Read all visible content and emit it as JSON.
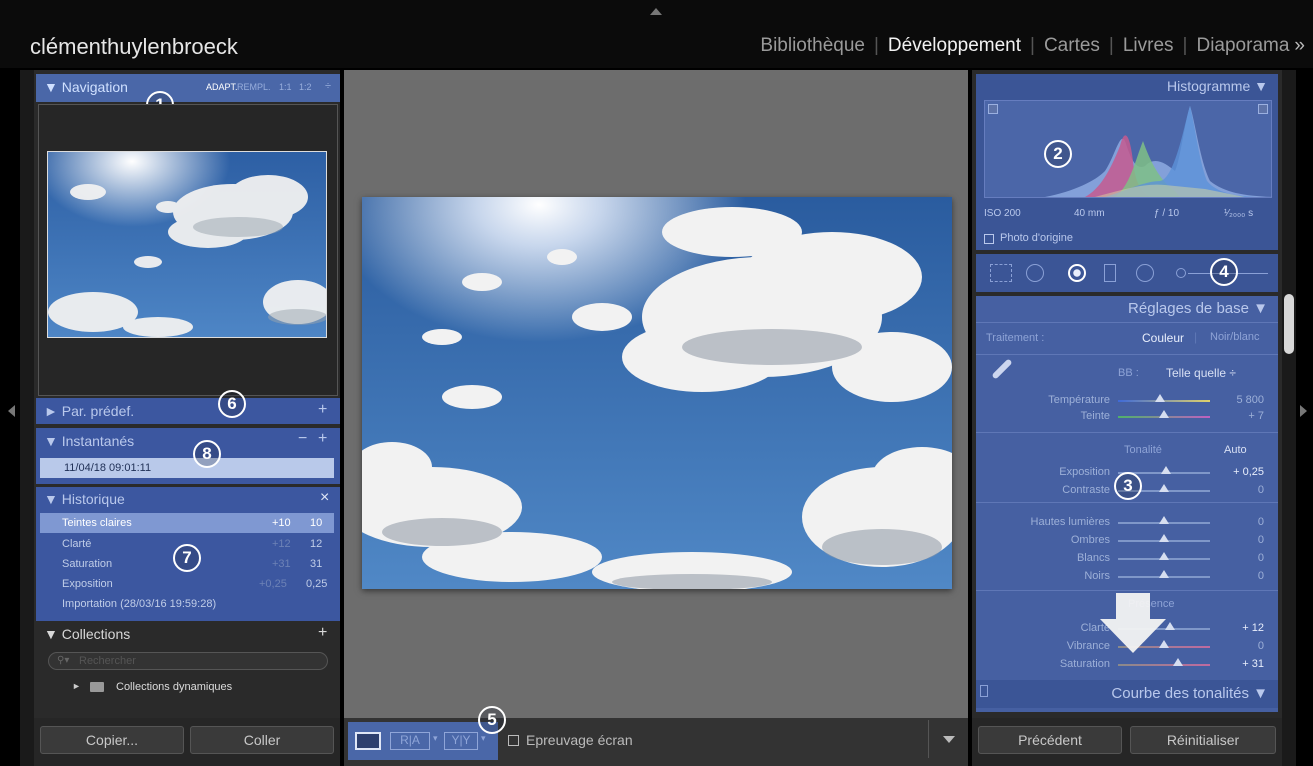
{
  "identity_plate": "clémenthuylenbroeck",
  "modules": [
    {
      "label": "Bibliothèque"
    },
    {
      "label": "Développement"
    },
    {
      "label": "Cartes"
    },
    {
      "label": "Livres"
    },
    {
      "label": "Diaporama"
    }
  ],
  "modules_more": "»",
  "colors": {
    "accent": "#4a67a8",
    "panel": "#2a2a2a",
    "center": "#6d6d6d"
  },
  "navigator": {
    "title": "Navigation",
    "zoom": [
      "ADAPT.",
      "REMPL.",
      "1:1",
      "1:2"
    ],
    "zoom_caret": "÷"
  },
  "presets": {
    "title": "Par. prédef.",
    "add": "+"
  },
  "snapshots": {
    "title": "Instantanés",
    "minus": "−",
    "add": "+",
    "items": [
      "11/04/18 09:01:11"
    ]
  },
  "history": {
    "title": "Historique",
    "close": "×",
    "items": [
      {
        "name": "Teintes claires",
        "delta": "+10",
        "value": "10"
      },
      {
        "name": "Clarté",
        "delta": "+12",
        "value": "12"
      },
      {
        "name": "Saturation",
        "delta": "+31",
        "value": "31"
      },
      {
        "name": "Exposition",
        "delta": "+0,25",
        "value": "0,25"
      },
      {
        "name": "Importation (28/03/16 19:59:28)",
        "delta": "",
        "value": ""
      }
    ]
  },
  "collections": {
    "title": "Collections",
    "add": "+",
    "search_placeholder": "Rechercher",
    "items": [
      "Collections dynamiques"
    ]
  },
  "left_buttons": {
    "copy": "Copier...",
    "paste": "Coller"
  },
  "toolbar": {
    "proof_label": "Epreuvage écran",
    "view_ra": "R|A",
    "view_yy": "Y|Y"
  },
  "histogram": {
    "title": "Histogramme",
    "iso": "ISO 200",
    "focal": "40 mm",
    "aperture": "ƒ / 10",
    "shutter": "¹⁄₂₀₀₀ s",
    "original_photo": "Photo d'origine"
  },
  "basic": {
    "title": "Réglages de base",
    "treatment_label": "Traitement :",
    "color": "Couleur",
    "bw": "Noir/blanc",
    "wb_label": "BB :",
    "wb_value": "Telle quelle ÷",
    "temp_label": "Température",
    "temp_value": "5 800",
    "tint_label": "Teinte",
    "tint_value": "+ 7",
    "tone_label": "Tonalité",
    "auto_label": "Auto",
    "sliders": [
      {
        "label": "Exposition",
        "value": "+ 0,25",
        "pos": 0.52
      },
      {
        "label": "Contraste",
        "value": "0",
        "pos": 0.5
      },
      {
        "label": "Hautes lumières",
        "value": "0",
        "pos": 0.5
      },
      {
        "label": "Ombres",
        "value": "0",
        "pos": 0.5
      },
      {
        "label": "Blancs",
        "value": "0",
        "pos": 0.5
      },
      {
        "label": "Noirs",
        "value": "0",
        "pos": 0.5
      },
      {
        "label": "Clarté",
        "value": "+ 12",
        "pos": 0.56
      },
      {
        "label": "Vibrance",
        "value": "0",
        "pos": 0.5
      },
      {
        "label": "Saturation",
        "value": "+ 31",
        "pos": 0.65
      }
    ],
    "presence_label": "Présence"
  },
  "tone_curve": {
    "title": "Courbe des tonalités"
  },
  "right_buttons": {
    "previous": "Précédent",
    "reset": "Réinitialiser"
  },
  "callouts": [
    "1",
    "2",
    "3",
    "4",
    "5",
    "6",
    "7",
    "8"
  ]
}
